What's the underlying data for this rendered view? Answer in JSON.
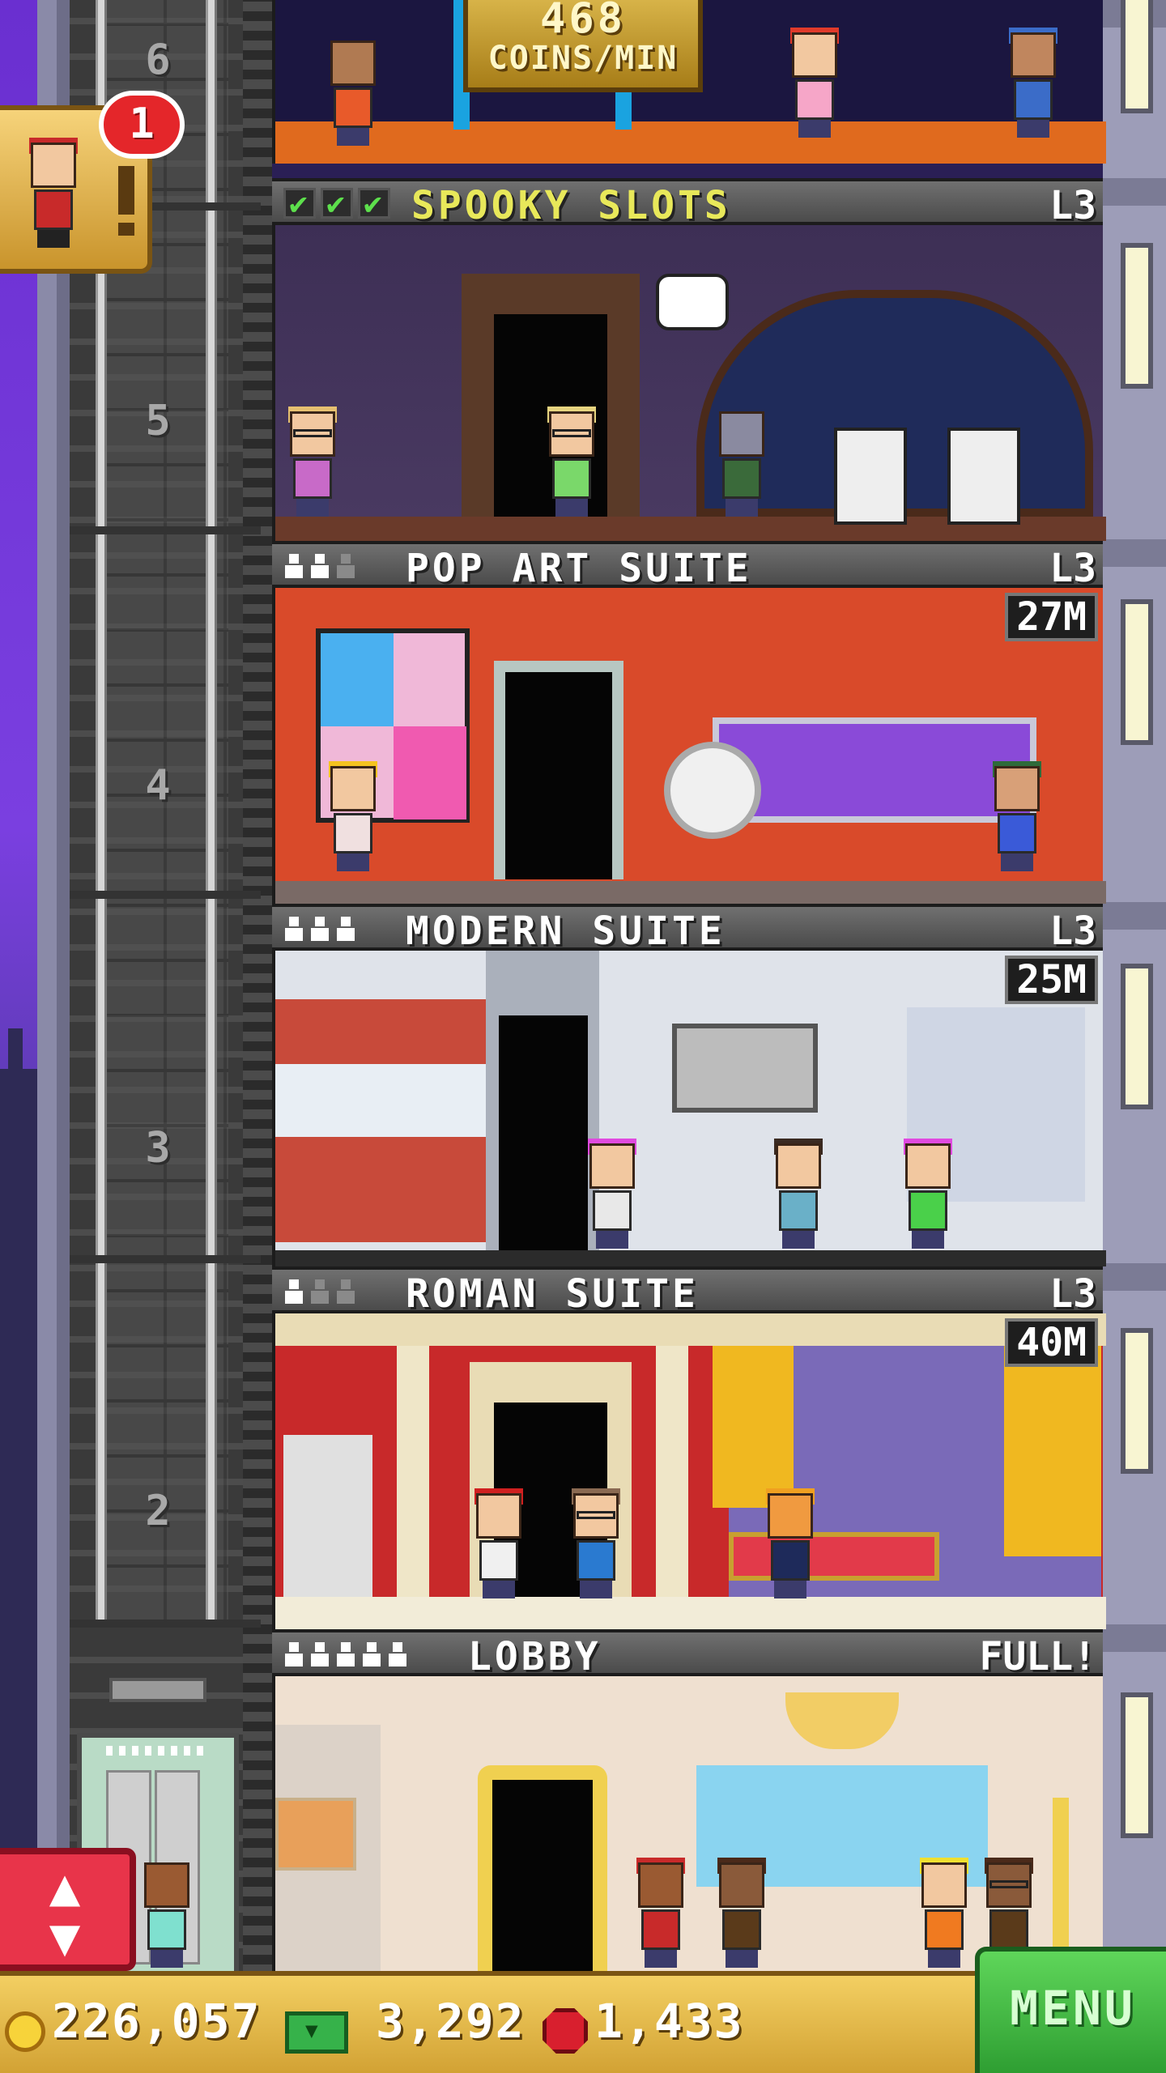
{
  "header": {
    "coins_per_min_value": "468",
    "coins_per_min_unit": "COINS/MIN"
  },
  "notification": {
    "count": "1",
    "icon": "bellhop-icon"
  },
  "shaft_floor_numbers": [
    "6",
    "5",
    "4",
    "3",
    "2"
  ],
  "floors": [
    {
      "name": "SPOOKY SLOTS",
      "level": "L3",
      "checks": 3,
      "cost": "",
      "pips_on": 0,
      "pips_total": 0
    },
    {
      "name": "POP ART SUITE",
      "level": "L3",
      "cost": "27M",
      "pips_on": 2,
      "pips_total": 3
    },
    {
      "name": "MODERN SUITE",
      "level": "L3",
      "cost": "25M",
      "pips_on": 3,
      "pips_total": 3
    },
    {
      "name": "ROMAN SUITE",
      "level": "L3",
      "cost": "40M",
      "pips_on": 1,
      "pips_total": 3
    },
    {
      "name": "LOBBY",
      "level": "FULL!",
      "cost": "",
      "pips_on": 5,
      "pips_total": 5
    }
  ],
  "bottom_bar": {
    "coins": "226,057",
    "bux": "3,292",
    "gems": "1,433",
    "menu_label": "MENU"
  },
  "elevator_button_icon": "up-down-arrows-icon",
  "colors": {
    "gold": "#d9b54a",
    "menu_green": "#2e9e32",
    "alert_red": "#e4262a",
    "check_green": "#5de04c",
    "spooky_label": "#e8e85a"
  }
}
